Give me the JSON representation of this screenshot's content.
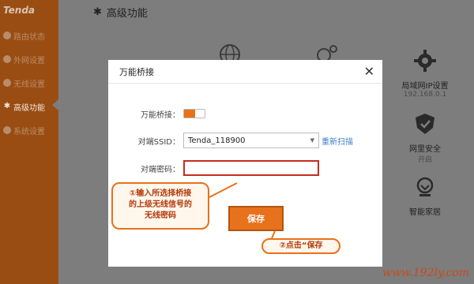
{
  "sidebar": {
    "logo": "Tenda",
    "items": [
      {
        "label": "路由状态",
        "icon": "status-dot-icon"
      },
      {
        "label": "外网设置",
        "icon": "status-dot-icon"
      },
      {
        "label": "无线设置",
        "icon": "status-dot-icon"
      },
      {
        "label": "高级功能",
        "icon": "wrench-icon",
        "active": true
      },
      {
        "label": "系统设置",
        "icon": "status-dot-icon"
      }
    ]
  },
  "main": {
    "title": "高级功能",
    "tiles": [
      {
        "label": "局域网IP设置",
        "sub": "192.168.0.1",
        "icon": "network-icon"
      },
      {
        "label": "网里安全",
        "sub": "开启",
        "icon": "shield-icon"
      },
      {
        "label": "智能家居",
        "sub": "",
        "icon": "smart-home-icon"
      }
    ]
  },
  "modal": {
    "title": "万能桥接",
    "close": "✕",
    "fields": {
      "bridge_label": "万能桥接：",
      "bridge_on": true,
      "ssid_label": "对端SSID：",
      "ssid_value": "Tenda_118900",
      "rescan": "重新扫描",
      "pwd_label": "对端密码：",
      "pwd_value": ""
    },
    "save": "保存"
  },
  "callouts": {
    "one_line1": "①输入所选择桥接",
    "one_line2": "的上级无线信号的",
    "one_line3": "无线密码",
    "two": "②点击“保存"
  },
  "watermark": "www.192ly.com",
  "colors": {
    "accent": "#e8711b",
    "sidebar": "#9a4d12",
    "alert": "#c42b1f",
    "link": "#3d7fc6"
  }
}
